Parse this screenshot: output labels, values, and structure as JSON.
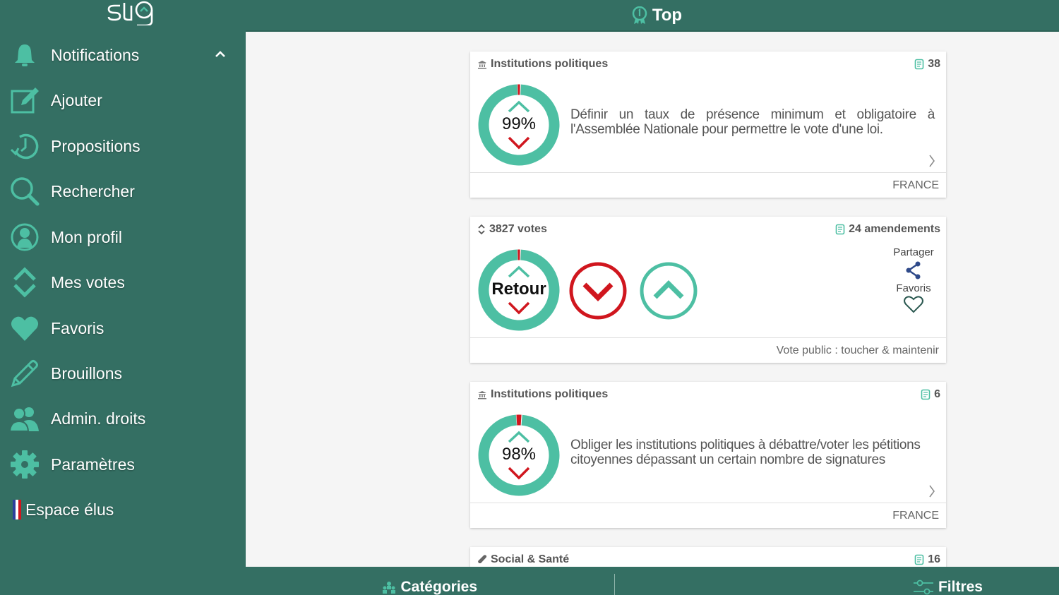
{
  "app": {
    "logo_text": "stig"
  },
  "colors": {
    "brand": "#346f63",
    "accent": "#4dbfa3",
    "negative": "#d0161e",
    "share": "#2f4a8a"
  },
  "header": {
    "title": "Top",
    "icon": "award-icon"
  },
  "sidebar": {
    "items": [
      {
        "label": "Notifications",
        "icon": "bell-icon",
        "expanded": true
      },
      {
        "label": "Ajouter",
        "icon": "edit-icon"
      },
      {
        "label": "Propositions",
        "icon": "history-icon"
      },
      {
        "label": "Rechercher",
        "icon": "search-icon"
      },
      {
        "label": "Mon profil",
        "icon": "user-circle-icon"
      },
      {
        "label": "Mes votes",
        "icon": "up-down-icon"
      },
      {
        "label": "Favoris",
        "icon": "heart-icon"
      },
      {
        "label": "Brouillons",
        "icon": "pencil-icon"
      },
      {
        "label": "Admin. droits",
        "icon": "users-icon"
      },
      {
        "label": "Paramètres",
        "icon": "gear-icon"
      }
    ],
    "elus": {
      "label": "Espace élus",
      "icon": "french-flag-icon"
    }
  },
  "cards": [
    {
      "category": "Institutions politiques",
      "category_icon": "institution-icon",
      "amendments": "38",
      "approval_percent": 99,
      "score_label": "99%",
      "text": "Définir un taux de présence minimum et obligatoire à l'Assemblée Nationale pour permettre le vote d'une loi.",
      "footer": "FRANCE"
    },
    {
      "votes_label": "3827 votes",
      "amendments_label": "24 amendements",
      "approval_percent": 99,
      "center_label": "Retour",
      "share_label": "Partager",
      "favorite_label": "Favoris",
      "footer": "Vote public : toucher & maintenir"
    },
    {
      "category": "Institutions politiques",
      "category_icon": "institution-icon",
      "amendments": "6",
      "approval_percent": 98,
      "score_label": "98%",
      "text": "Obliger les institutions politiques à débattre/voter les pétitions citoyennes dépassant un certain nombre de signatures",
      "footer": "FRANCE"
    },
    {
      "category": "Social & Santé",
      "category_icon": "bandage-icon",
      "amendments": "16"
    }
  ],
  "bottombar": {
    "categories_label": "Catégories",
    "filters_label": "Filtres"
  }
}
